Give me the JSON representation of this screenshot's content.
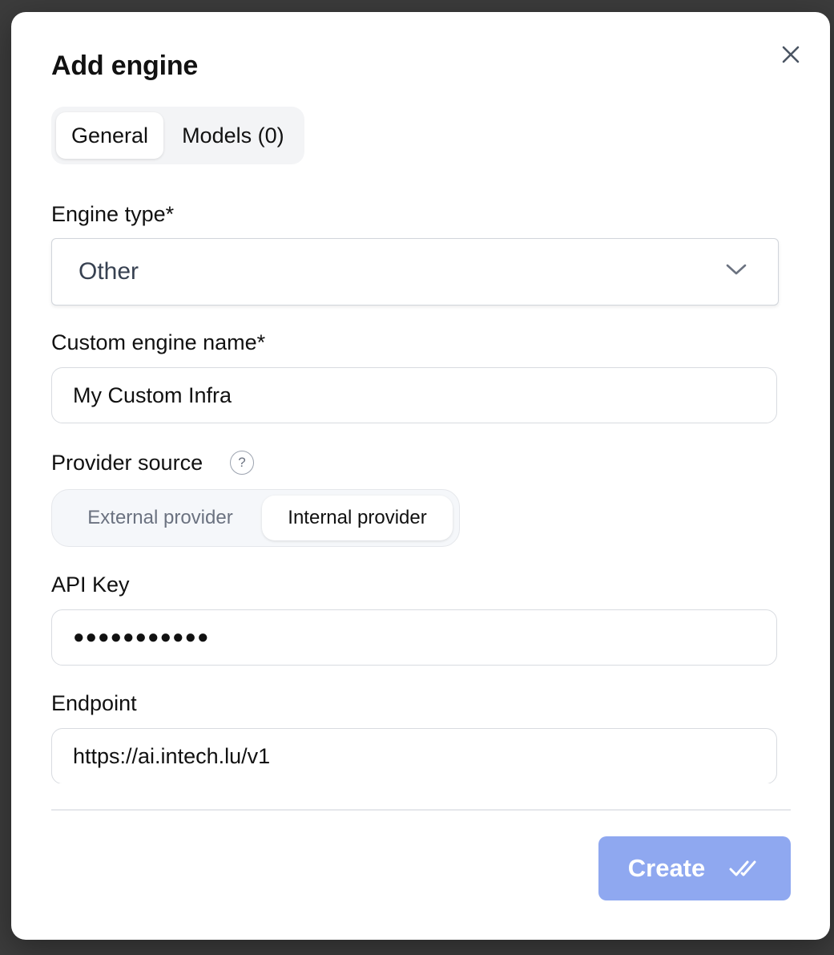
{
  "dialog": {
    "title": "Add engine",
    "close_icon": "close-icon"
  },
  "tabs": [
    {
      "label": "General",
      "active": true
    },
    {
      "label": "Models (0)",
      "active": false
    }
  ],
  "engine_type": {
    "label": "Engine type*",
    "value": "Other",
    "icon": "chevron-down-icon"
  },
  "custom_engine_name": {
    "label": "Custom engine name*",
    "value": "My Custom Infra"
  },
  "provider_source": {
    "label": "Provider source",
    "help_symbol": "?",
    "options": [
      "External provider",
      "Internal provider"
    ],
    "selected": "Internal provider"
  },
  "api_key": {
    "label": "API Key",
    "value": "●●●●●●●●●●●"
  },
  "endpoint": {
    "label": "Endpoint",
    "value": "https://ai.intech.lu/v1"
  },
  "footer": {
    "create_label": "Create",
    "create_icon": "double-check-icon",
    "create_color": "#8fa8f0"
  }
}
